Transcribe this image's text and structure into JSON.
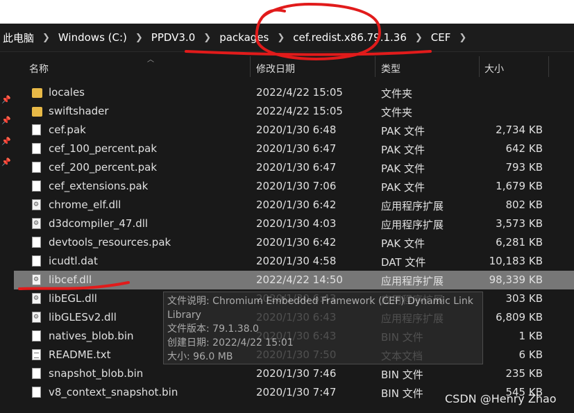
{
  "breadcrumb": [
    "此电脑",
    "Windows (C:)",
    "PPDV3.0",
    "packages",
    "cef.redist.x86.79.1.36",
    "CEF"
  ],
  "columns": {
    "name": "名称",
    "date": "修改日期",
    "type": "类型",
    "size": "大小"
  },
  "files": [
    {
      "name": "locales",
      "date": "2022/4/22 15:05",
      "type": "文件夹",
      "size": "",
      "icon": "folder-icon"
    },
    {
      "name": "swiftshader",
      "date": "2022/4/22 15:05",
      "type": "文件夹",
      "size": "",
      "icon": "folder-icon"
    },
    {
      "name": "cef.pak",
      "date": "2020/1/30 6:48",
      "type": "PAK 文件",
      "size": "2,734 KB",
      "icon": "file-icon"
    },
    {
      "name": "cef_100_percent.pak",
      "date": "2020/1/30 6:47",
      "type": "PAK 文件",
      "size": "642 KB",
      "icon": "file-icon"
    },
    {
      "name": "cef_200_percent.pak",
      "date": "2020/1/30 6:47",
      "type": "PAK 文件",
      "size": "793 KB",
      "icon": "file-icon"
    },
    {
      "name": "cef_extensions.pak",
      "date": "2020/1/30 7:06",
      "type": "PAK 文件",
      "size": "1,679 KB",
      "icon": "file-icon"
    },
    {
      "name": "chrome_elf.dll",
      "date": "2020/1/30 6:42",
      "type": "应用程序扩展",
      "size": "802 KB",
      "icon": "dll-icon"
    },
    {
      "name": "d3dcompiler_47.dll",
      "date": "2020/1/30 4:03",
      "type": "应用程序扩展",
      "size": "3,573 KB",
      "icon": "dll-icon"
    },
    {
      "name": "devtools_resources.pak",
      "date": "2020/1/30 6:42",
      "type": "PAK 文件",
      "size": "6,281 KB",
      "icon": "file-icon"
    },
    {
      "name": "icudtl.dat",
      "date": "2020/1/30 4:58",
      "type": "DAT 文件",
      "size": "10,183 KB",
      "icon": "file-icon"
    },
    {
      "name": "libcef.dll",
      "date": "2022/4/22 14:50",
      "type": "应用程序扩展",
      "size": "98,339 KB",
      "icon": "dll-icon",
      "selected": true
    },
    {
      "name": "libEGL.dll",
      "date": "2020/1/30 6:43",
      "type": "应用程序扩展",
      "size": "303 KB",
      "icon": "dll-icon"
    },
    {
      "name": "libGLESv2.dll",
      "date": "2020/1/30 6:43",
      "type": "应用程序扩展",
      "size": "6,809 KB",
      "icon": "dll-icon"
    },
    {
      "name": "natives_blob.bin",
      "date": "2020/1/30 6:43",
      "type": "BIN 文件",
      "size": "1 KB",
      "icon": "file-icon"
    },
    {
      "name": "README.txt",
      "date": "2020/1/30 7:50",
      "type": "文本文档",
      "size": "6 KB",
      "icon": "txt-icon"
    },
    {
      "name": "snapshot_blob.bin",
      "date": "2020/1/30 7:46",
      "type": "BIN 文件",
      "size": "235 KB",
      "icon": "file-icon"
    },
    {
      "name": "v8_context_snapshot.bin",
      "date": "2020/1/30 7:47",
      "type": "BIN 文件",
      "size": "545 KB",
      "icon": "file-icon"
    }
  ],
  "tooltip": {
    "line1": "文件说明: Chromium Embedded Framework (CEF) Dynamic Link",
    "line2": "Library",
    "line3": "文件版本: 79.1.38.0",
    "line4": "创建日期: 2022/4/22 15:01",
    "line5": "大小: 96.0 MB"
  },
  "watermark": "CSDN @Henry Zhao",
  "colors": {
    "background": "#191919",
    "selected_row": "#777777",
    "annotation_red": "#e11b1b",
    "folder": "#e8b947"
  }
}
